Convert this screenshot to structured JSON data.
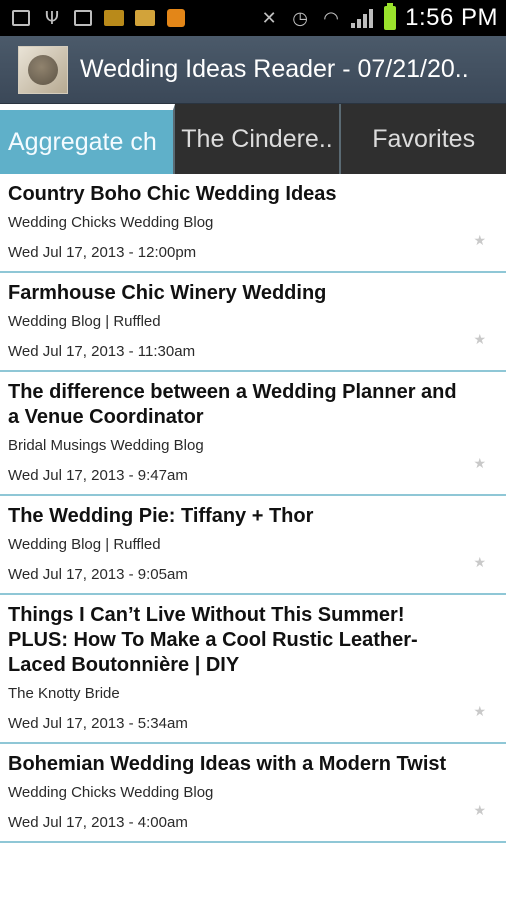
{
  "status_bar": {
    "time": "1:56 PM",
    "icons": [
      "add-notification-icon",
      "usb-icon",
      "image-icon",
      "app-notification-icon",
      "app-notification-icon",
      "rss-icon",
      "mute-icon",
      "alarm-icon",
      "wifi-icon",
      "signal-icon",
      "battery-icon"
    ]
  },
  "app": {
    "title": "Wedding Ideas Reader - 07/21/20.."
  },
  "tabs": [
    {
      "label": "Aggregate ch"
    },
    {
      "label": "The Cindere.."
    },
    {
      "label": "Favorites"
    }
  ],
  "colors": {
    "active_tab": "#5fb0c9",
    "divider": "#8fc7d6",
    "action_bar": "#3f4d5d"
  },
  "articles": [
    {
      "title": "Country Boho Chic Wedding Ideas",
      "source": "Wedding Chicks Wedding Blog",
      "date": "Wed Jul 17, 2013 - 12:00pm"
    },
    {
      "title": "Farmhouse Chic Winery Wedding",
      "source": "Wedding Blog | Ruffled",
      "date": "Wed Jul 17, 2013 - 11:30am"
    },
    {
      "title": "The difference between a Wedding Planner and a Venue Coordinator",
      "source": "Bridal Musings Wedding Blog",
      "date": "Wed Jul 17, 2013 - 9:47am"
    },
    {
      "title": "The Wedding Pie: Tiffany + Thor",
      "source": "Wedding Blog | Ruffled",
      "date": "Wed Jul 17, 2013 - 9:05am"
    },
    {
      "title": "Things I Can’t Live Without This Summer! PLUS: How To Make a Cool Rustic Leather-Laced Boutonnière | DIY",
      "source": "The Knotty Bride",
      "date": "Wed Jul 17, 2013 - 5:34am"
    },
    {
      "title": "Bohemian Wedding Ideas with a Modern Twist",
      "source": "Wedding Chicks Wedding Blog",
      "date": "Wed Jul 17, 2013 - 4:00am"
    }
  ]
}
